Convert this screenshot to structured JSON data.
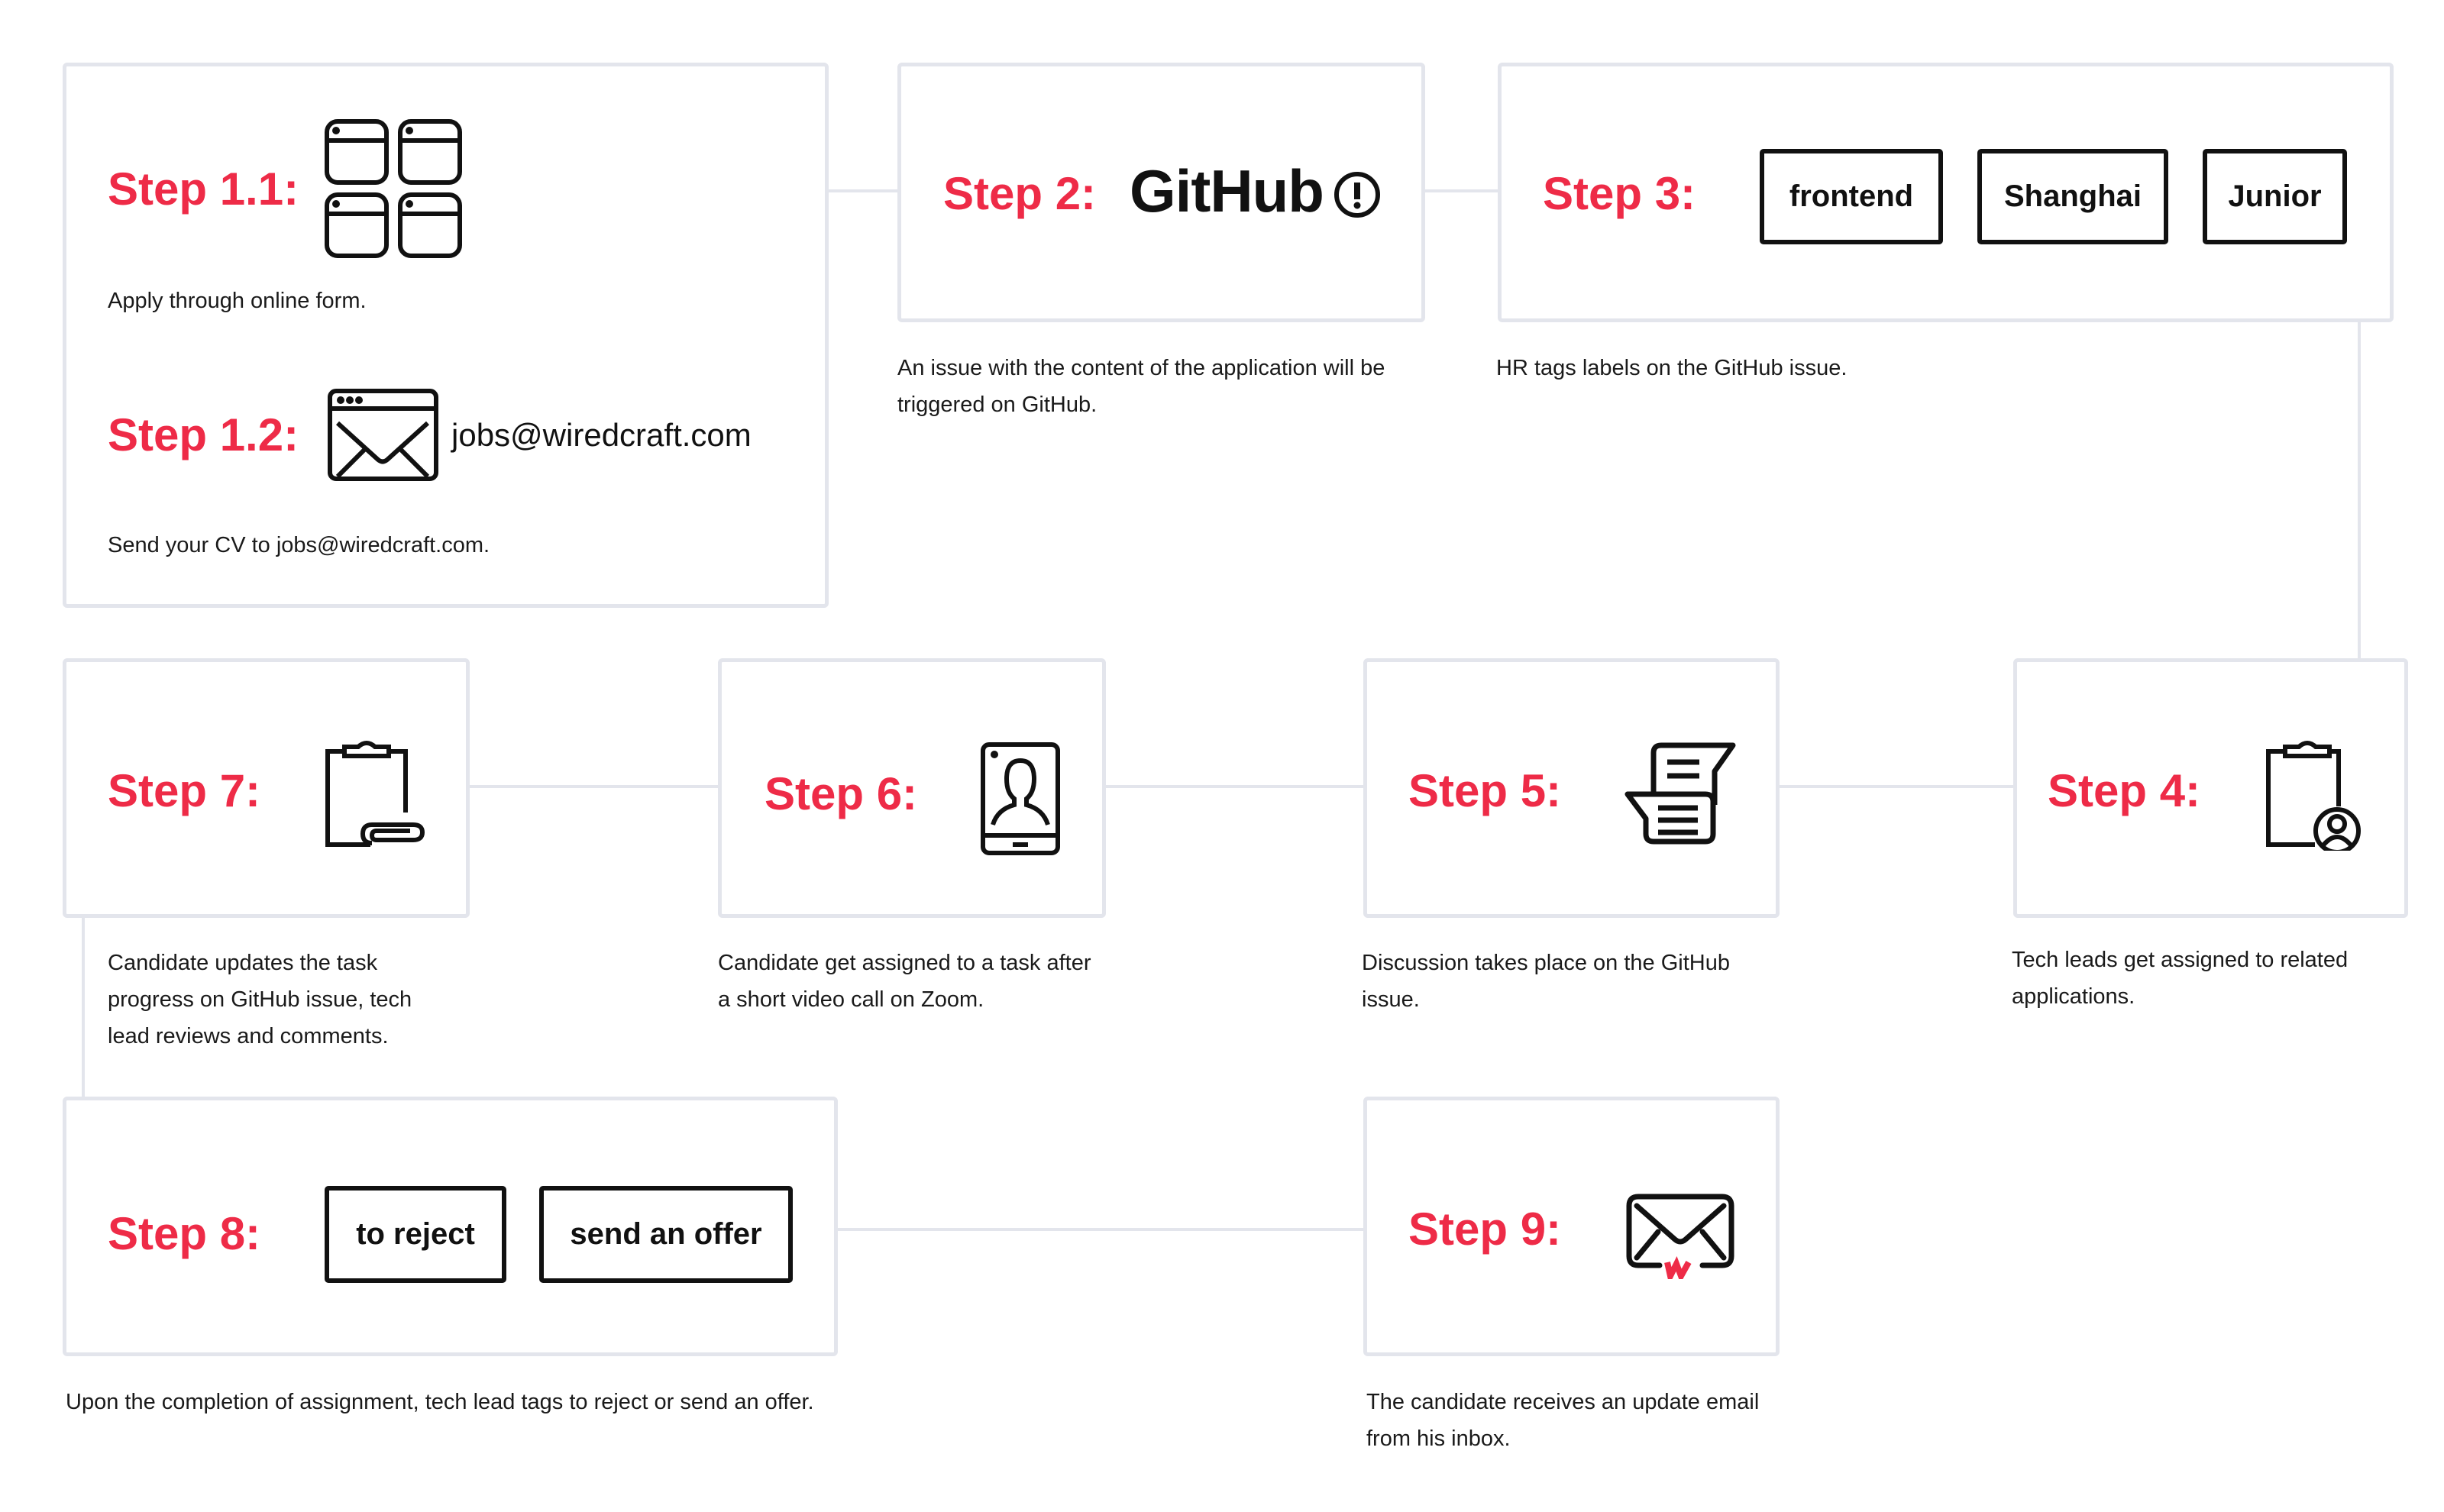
{
  "colors": {
    "accent": "#ee2b47",
    "connector": "#e3e5ec",
    "ink": "#111111"
  },
  "steps": {
    "s1_1": {
      "label": "Step 1.1:",
      "icon": "browser-windows-grid-icon",
      "desc": "Apply through online form."
    },
    "s1_2": {
      "label": "Step 1.2:",
      "icon": "email-window-icon",
      "email": "jobs@wiredcraft.com",
      "desc": "Send your CV to jobs@wiredcraft.com."
    },
    "s2": {
      "label": "Step 2:",
      "logo": "GitHub",
      "icon": "issue-alert-icon",
      "desc": "An issue with the content of the application will be triggered on GitHub."
    },
    "s3": {
      "label": "Step 3:",
      "tags": [
        "frontend",
        "Shanghai",
        "Junior"
      ],
      "desc": "HR tags labels on the GitHub issue."
    },
    "s4": {
      "label": "Step 4:",
      "icon": "clipboard-user-icon",
      "desc": "Tech leads get assigned to related applications."
    },
    "s5": {
      "label": "Step 5:",
      "icon": "chat-bubbles-icon",
      "desc": "Discussion takes place on the GitHub issue."
    },
    "s6": {
      "label": "Step 6:",
      "icon": "tablet-video-call-icon",
      "desc": "Candidate get assigned to a task after a short video call on Zoom."
    },
    "s7": {
      "label": "Step 7:",
      "icon": "clipboard-attachment-icon",
      "desc": "Candidate updates the task progress on GitHub issue, tech lead reviews and comments."
    },
    "s8": {
      "label": "Step 8:",
      "tags": [
        "to reject",
        "send an offer"
      ],
      "desc": "Upon the completion of assignment, tech lead tags to reject or send an offer."
    },
    "s9": {
      "label": "Step 9:",
      "icon": "envelope-wiredcraft-icon",
      "desc": "The candidate receives an update email from his inbox."
    }
  }
}
